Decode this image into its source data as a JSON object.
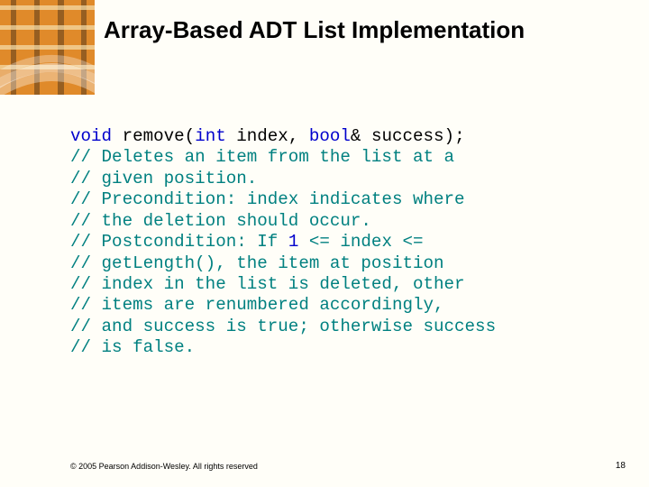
{
  "slide": {
    "title": "Array-Based ADT List Implementation"
  },
  "code": {
    "signature": {
      "kw_void": "void",
      "space1": " remove(",
      "kw_int": "int",
      "mid": " index, ",
      "kw_bool": "bool",
      "tail": "& success);"
    },
    "comments": [
      "// Deletes an item from the list at a",
      "// given position.",
      "// Precondition: index indicates where",
      "// the deletion should occur."
    ],
    "postcond": {
      "pre": "// Postcondition: If ",
      "one": "1",
      "post": " <= index <="
    },
    "comments2": [
      "// getLength(), the item at position",
      "// index in the list is deleted, other",
      "// items are renumbered accordingly,",
      "// and success is true; otherwise success",
      "// is false."
    ]
  },
  "footer": {
    "copyright": "© 2005 Pearson Addison-Wesley. All rights reserved",
    "page": "18"
  }
}
